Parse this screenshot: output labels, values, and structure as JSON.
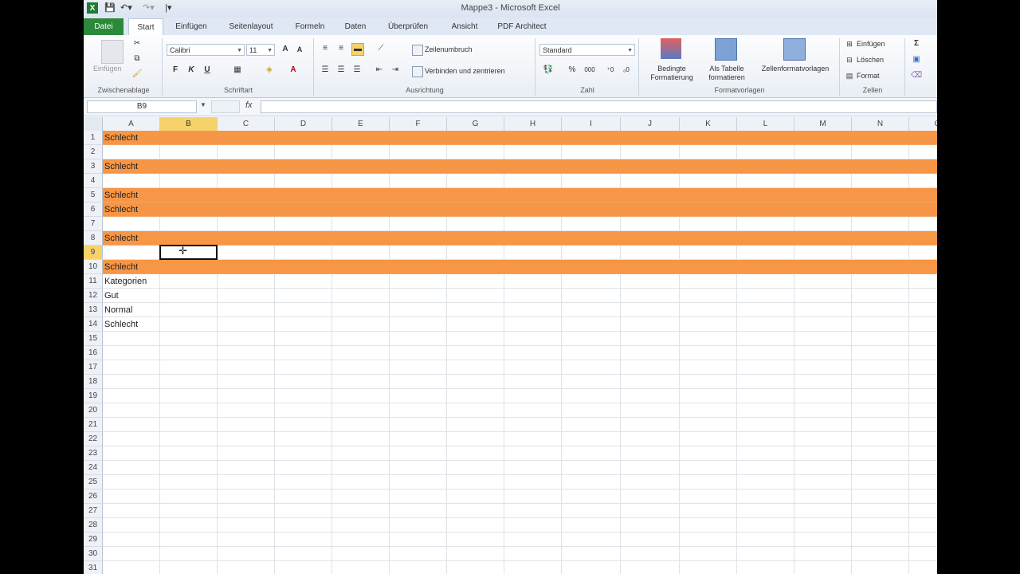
{
  "window": {
    "title": "Mappe3 - Microsoft Excel"
  },
  "tabs": [
    "Datei",
    "Start",
    "Einfügen",
    "Seitenlayout",
    "Formeln",
    "Daten",
    "Überprüfen",
    "Ansicht",
    "PDF Architect"
  ],
  "ribbon": {
    "clipboard": {
      "paste": "Einfügen",
      "label": "Zwischenablage"
    },
    "font": {
      "name": "Calibri",
      "size": "11",
      "label": "Schriftart"
    },
    "alignment": {
      "wrap": "Zeilenumbruch",
      "merge": "Verbinden und zentrieren",
      "label": "Ausrichtung"
    },
    "number": {
      "format": "Standard",
      "label": "Zahl"
    },
    "styles": {
      "cond1": "Bedingte",
      "cond2": "Formatierung",
      "table1": "Als Tabelle",
      "table2": "formatieren",
      "cell": "Zellenformatvorlagen",
      "label": "Formatvorlagen"
    },
    "cells": {
      "insert": "Einfügen",
      "delete": "Löschen",
      "format": "Format",
      "label": "Zellen"
    }
  },
  "formula_bar": {
    "name_box": "B9",
    "fx": "fx",
    "content": ""
  },
  "grid": {
    "columns": [
      "A",
      "B",
      "C",
      "D",
      "E",
      "F",
      "G",
      "H",
      "I",
      "J",
      "K",
      "L",
      "M",
      "N",
      "O"
    ],
    "selected_cell": "B9",
    "highlight_color": "#F79646",
    "rows": [
      {
        "n": "1",
        "a": "Schlecht",
        "highlight": true
      },
      {
        "n": "2",
        "a": "",
        "highlight": false
      },
      {
        "n": "3",
        "a": "Schlecht",
        "highlight": true
      },
      {
        "n": "4",
        "a": "",
        "highlight": false
      },
      {
        "n": "5",
        "a": "Schlecht",
        "highlight": true
      },
      {
        "n": "6",
        "a": "Schlecht",
        "highlight": true
      },
      {
        "n": "7",
        "a": "",
        "highlight": false
      },
      {
        "n": "8",
        "a": "Schlecht",
        "highlight": true
      },
      {
        "n": "9",
        "a": "",
        "highlight": false
      },
      {
        "n": "10",
        "a": "Schlecht",
        "highlight": true
      },
      {
        "n": "11",
        "a": "Kategorien",
        "highlight": false
      },
      {
        "n": "12",
        "a": "Gut",
        "highlight": false
      },
      {
        "n": "13",
        "a": "Normal",
        "highlight": false
      },
      {
        "n": "14",
        "a": "Schlecht",
        "highlight": false
      },
      {
        "n": "15",
        "a": "",
        "highlight": false
      },
      {
        "n": "16",
        "a": "",
        "highlight": false
      },
      {
        "n": "17",
        "a": "",
        "highlight": false
      },
      {
        "n": "18",
        "a": "",
        "highlight": false
      },
      {
        "n": "19",
        "a": "",
        "highlight": false
      },
      {
        "n": "20",
        "a": "",
        "highlight": false
      },
      {
        "n": "21",
        "a": "",
        "highlight": false
      },
      {
        "n": "22",
        "a": "",
        "highlight": false
      },
      {
        "n": "23",
        "a": "",
        "highlight": false
      },
      {
        "n": "24",
        "a": "",
        "highlight": false
      },
      {
        "n": "25",
        "a": "",
        "highlight": false
      },
      {
        "n": "26",
        "a": "",
        "highlight": false
      },
      {
        "n": "27",
        "a": "",
        "highlight": false
      },
      {
        "n": "28",
        "a": "",
        "highlight": false
      },
      {
        "n": "29",
        "a": "",
        "highlight": false
      },
      {
        "n": "30",
        "a": "",
        "highlight": false
      },
      {
        "n": "31",
        "a": "",
        "highlight": false
      }
    ]
  }
}
